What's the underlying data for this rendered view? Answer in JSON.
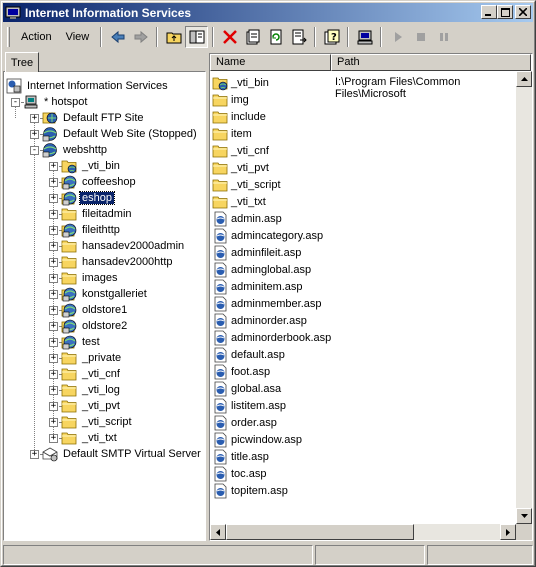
{
  "window": {
    "title": "Internet Information Services"
  },
  "menu": {
    "action": "Action",
    "view": "View"
  },
  "tabs": {
    "tree": "Tree"
  },
  "columns": {
    "name": "Name",
    "path": "Path"
  },
  "tree": {
    "root": "Internet Information Services",
    "server": "* hotspot",
    "sites": [
      {
        "label": "Default FTP Site"
      },
      {
        "label": "Default Web Site (Stopped)"
      },
      {
        "label": "webshttp"
      }
    ],
    "children": [
      {
        "label": "_vti_bin",
        "icon": "globe-folder-icon"
      },
      {
        "label": "coffeeshop",
        "icon": "web-app-icon"
      },
      {
        "label": "eshop",
        "icon": "web-app-icon"
      },
      {
        "label": "fileitadmin",
        "icon": "folder-icon"
      },
      {
        "label": "fileithttp",
        "icon": "web-app-icon"
      },
      {
        "label": "hansadev2000admin",
        "icon": "folder-icon"
      },
      {
        "label": "hansadev2000http",
        "icon": "folder-icon"
      },
      {
        "label": "images",
        "icon": "folder-icon"
      },
      {
        "label": "konstgalleriet",
        "icon": "web-app-icon"
      },
      {
        "label": "oldstore1",
        "icon": "web-app-icon"
      },
      {
        "label": "oldstore2",
        "icon": "web-app-icon"
      },
      {
        "label": "test",
        "icon": "web-app-icon"
      },
      {
        "label": "_private",
        "icon": "folder-icon"
      },
      {
        "label": "_vti_cnf",
        "icon": "folder-icon"
      },
      {
        "label": "_vti_log",
        "icon": "folder-icon"
      },
      {
        "label": "_vti_pvt",
        "icon": "folder-icon"
      },
      {
        "label": "_vti_script",
        "icon": "folder-icon"
      },
      {
        "label": "_vti_txt",
        "icon": "folder-icon"
      }
    ],
    "smtp": "Default SMTP Virtual Server"
  },
  "list": [
    {
      "name": "_vti_bin",
      "path": "I:\\Program Files\\Common Files\\Microsoft",
      "icon": "globe-folder-icon"
    },
    {
      "name": "img",
      "icon": "folder-icon"
    },
    {
      "name": "include",
      "icon": "folder-icon"
    },
    {
      "name": "item",
      "icon": "folder-icon"
    },
    {
      "name": "_vti_cnf",
      "icon": "folder-icon"
    },
    {
      "name": "_vti_pvt",
      "icon": "folder-icon"
    },
    {
      "name": "_vti_script",
      "icon": "folder-icon"
    },
    {
      "name": "_vti_txt",
      "icon": "folder-icon"
    },
    {
      "name": "admin.asp",
      "icon": "asp-file-icon"
    },
    {
      "name": "admincategory.asp",
      "icon": "asp-file-icon"
    },
    {
      "name": "adminfileit.asp",
      "icon": "asp-file-icon"
    },
    {
      "name": "adminglobal.asp",
      "icon": "asp-file-icon"
    },
    {
      "name": "adminitem.asp",
      "icon": "asp-file-icon"
    },
    {
      "name": "adminmember.asp",
      "icon": "asp-file-icon"
    },
    {
      "name": "adminorder.asp",
      "icon": "asp-file-icon"
    },
    {
      "name": "adminorderbook.asp",
      "icon": "asp-file-icon"
    },
    {
      "name": "default.asp",
      "icon": "asp-file-icon"
    },
    {
      "name": "foot.asp",
      "icon": "asp-file-icon"
    },
    {
      "name": "global.asa",
      "icon": "asp-file-icon"
    },
    {
      "name": "listitem.asp",
      "icon": "asp-file-icon"
    },
    {
      "name": "order.asp",
      "icon": "asp-file-icon"
    },
    {
      "name": "picwindow.asp",
      "icon": "asp-file-icon"
    },
    {
      "name": "title.asp",
      "icon": "asp-file-icon"
    },
    {
      "name": "toc.asp",
      "icon": "asp-file-icon"
    },
    {
      "name": "topitem.asp",
      "icon": "asp-file-icon"
    }
  ],
  "selected": "eshop",
  "colors": {
    "titlebar": "#0a246a",
    "folder": "#f7d560",
    "selection": "#0a246a"
  }
}
